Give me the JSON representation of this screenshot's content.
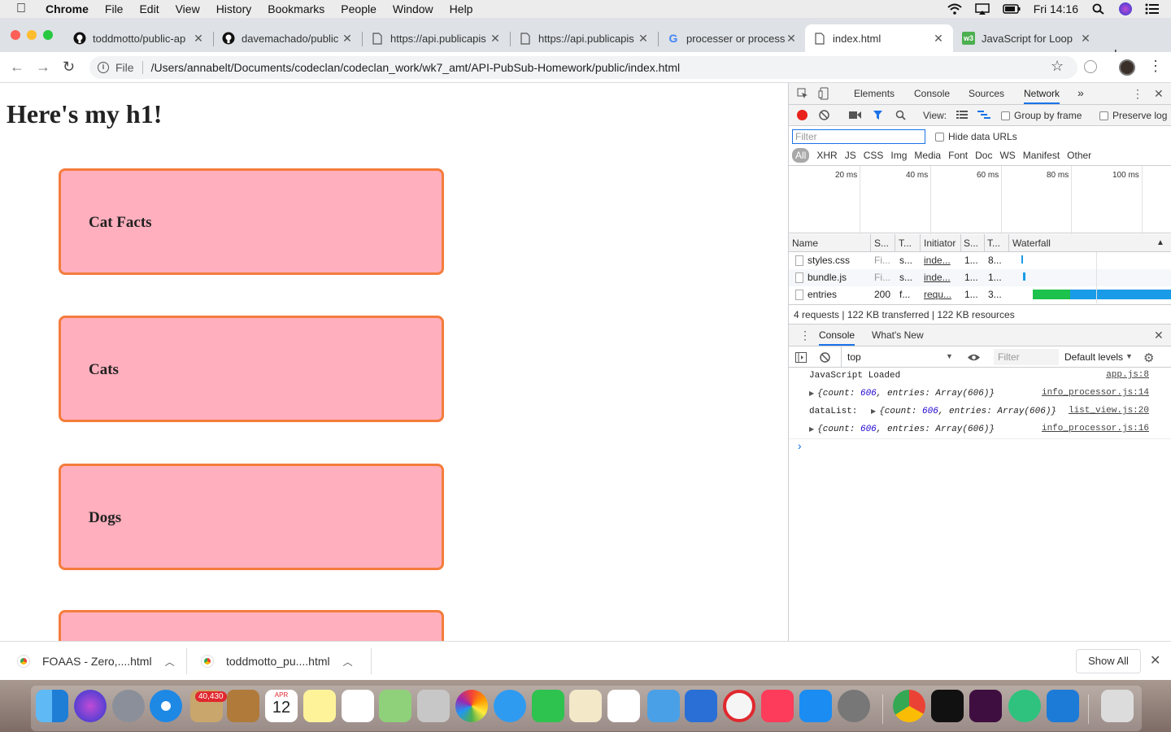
{
  "menubar": {
    "items": [
      "Chrome",
      "File",
      "Edit",
      "View",
      "History",
      "Bookmarks",
      "People",
      "Window",
      "Help"
    ],
    "clock": "Fri 14:16"
  },
  "tabs": [
    {
      "title": "toddmotto/public-ap",
      "icon": "github-icon"
    },
    {
      "title": "davemachado/public",
      "icon": "github-icon"
    },
    {
      "title": "https://api.publicapis",
      "icon": "document-icon"
    },
    {
      "title": "https://api.publicapis",
      "icon": "document-icon"
    },
    {
      "title": "processer or process",
      "icon": "google-icon"
    },
    {
      "title": "index.html",
      "icon": "document-icon"
    },
    {
      "title": "JavaScript for Loop",
      "icon": "w3-icon"
    }
  ],
  "omnibox": {
    "scheme": "File",
    "url": "/Users/annabelt/Documents/codeclan/codeclan_work/wk7_amt/API-PubSub-Homework/public/index.html"
  },
  "page": {
    "heading": "Here's my h1!",
    "cards": [
      "Cat Facts",
      "Cats",
      "Dogs",
      ""
    ]
  },
  "devtools": {
    "tabs": [
      "Elements",
      "Console",
      "Sources",
      "Network"
    ],
    "more": "»",
    "view_label": "View:",
    "group_by_frame": "Group by frame",
    "preserve_log": "Preserve log",
    "filter_placeholder": "Filter",
    "hide_data_urls": "Hide data URLs",
    "types": [
      "All",
      "XHR",
      "JS",
      "CSS",
      "Img",
      "Media",
      "Font",
      "Doc",
      "WS",
      "Manifest",
      "Other"
    ],
    "timeline_labels": [
      "20 ms",
      "40 ms",
      "60 ms",
      "80 ms",
      "100 ms"
    ],
    "columns": [
      "Name",
      "S...",
      "T...",
      "Initiator",
      "S...",
      "T...",
      "Waterfall"
    ],
    "rows": [
      {
        "name": "styles.css",
        "status": "Fi...",
        "type": "s...",
        "initiator": "inde...",
        "size": "1...",
        "time": "8..."
      },
      {
        "name": "bundle.js",
        "status": "Fi...",
        "type": "s...",
        "initiator": "inde...",
        "size": "1...",
        "time": "1..."
      },
      {
        "name": "entries",
        "status": "200",
        "type": "f...",
        "initiator": "requ...",
        "size": "1...",
        "time": "3..."
      }
    ],
    "summary": "4 requests | 122 KB transferred | 122 KB resources",
    "drawer_tabs": [
      "Console",
      "What's New"
    ],
    "context": "top",
    "console_filter": "Filter",
    "levels": "Default levels",
    "console": [
      {
        "text": "JavaScript Loaded",
        "source": "app.js:8"
      },
      {
        "prefix": "",
        "obj_open": "{count: ",
        "count": "606",
        "obj_rest": ", entries: Array(606)}",
        "source": "info_processor.js:14"
      },
      {
        "prefix": "dataList:",
        "obj_open": "{count: ",
        "count": "606",
        "obj_rest": ", entries: Array(606)}",
        "source": "list_view.js:20"
      },
      {
        "prefix": "",
        "obj_open": "{count: ",
        "count": "606",
        "obj_rest": ", entries: Array(606)}",
        "source": "info_processor.js:16"
      }
    ],
    "prompt": "›"
  },
  "downloads": {
    "items": [
      "FOAAS - Zero,....html",
      "toddmotto_pu....html"
    ],
    "show_all": "Show All"
  },
  "dock": {
    "mail_badge": "40,430",
    "calendar_month": "APR",
    "calendar_day": "12"
  }
}
